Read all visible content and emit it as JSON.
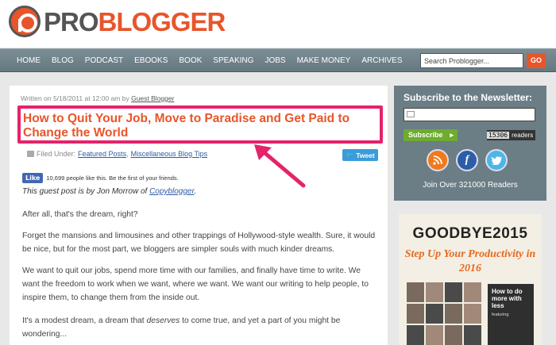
{
  "header": {
    "logo_pro": "PRO",
    "logo_blogger": "BLOGGER"
  },
  "nav": {
    "items": [
      "HOME",
      "BLOG",
      "PODCAST",
      "EBOOKS",
      "BOOK",
      "SPEAKING",
      "JOBS",
      "MAKE MONEY",
      "ARCHIVES"
    ],
    "search_placeholder": "Search Problogger...",
    "go_label": "GO"
  },
  "post": {
    "byline_prefix": "Written on 5/18/2011 at 12:00 am by",
    "byline_author": "Guest Blogger",
    "title": "How to Quit Your Job, Move to Paradise and Get Paid to Change the World",
    "filed_prefix": "Filed Under:",
    "filed_cat1": "Featured Posts",
    "filed_sep": ",",
    "filed_cat2": "Miscellaneous Blog Tips",
    "tweet_label": "Tweet",
    "fb_like_label": "Like",
    "fb_like_text": "10,699 people like this. Be the first of your friends.",
    "guest_prefix": "This guest post is by Jon Morrow of",
    "guest_link": "Copyblogger",
    "guest_suffix": ".",
    "p1": "After all, that's the dream, right?",
    "p2": "Forget the mansions and limousines and other trappings of Hollywood-style wealth. Sure, it would be nice, but for the most part, we bloggers are simpler souls with much kinder dreams.",
    "p3": "We want to quit our jobs, spend more time with our families, and finally have time to write. We want the freedom to work when we want, where we want. We want our writing to help people, to inspire them, to change them from the inside out.",
    "p4_a": "It's a modest dream, a dream that",
    "p4_em": "deserves",
    "p4_b": "to come true, and yet a part of you might be wondering..."
  },
  "sidebar": {
    "title": "Subscribe to the Newsletter:",
    "subscribe_label": "Subscribe",
    "counter_num": "15306",
    "counter_label": "readers",
    "fb_letter": "f",
    "join_text": "Join Over 321000 Readers"
  },
  "ad": {
    "headline": "GOODBYE2015",
    "subline": "Step Up Your Productivity in 2016",
    "book_title": "How to do more with less",
    "book_label": "featuring"
  },
  "colors": {
    "accent": "#e8552b",
    "highlight": "#e5226a",
    "nav": "#6b7d85"
  }
}
